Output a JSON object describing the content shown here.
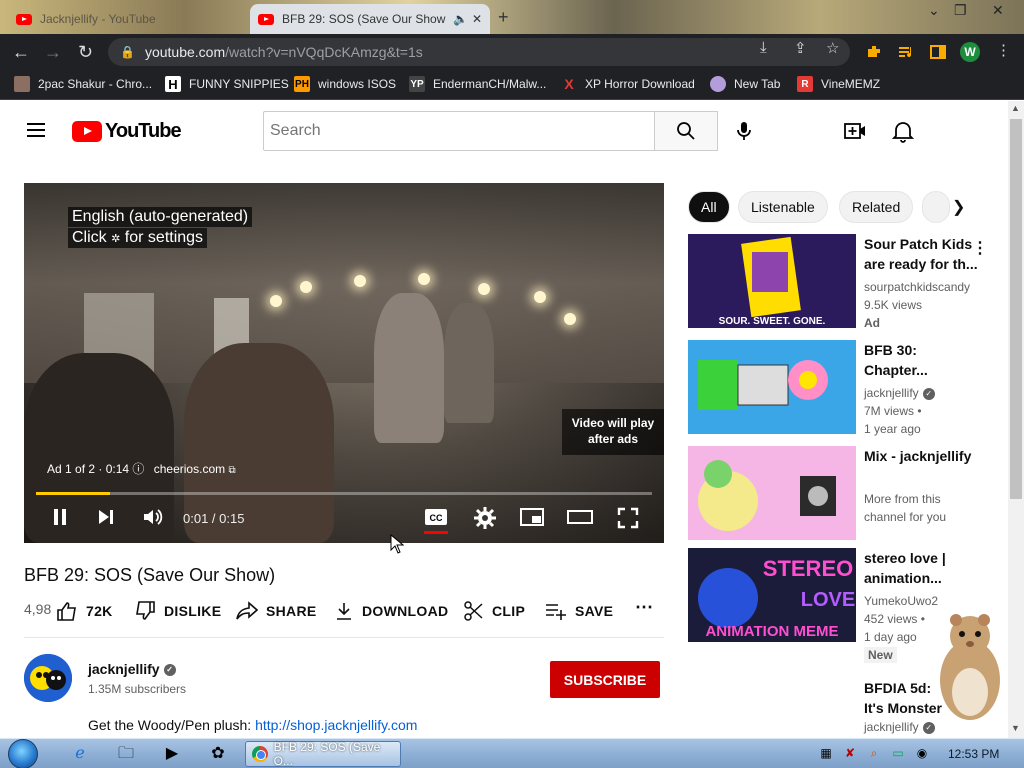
{
  "browser": {
    "tabs": [
      {
        "title": "Jacknjellify - YouTube",
        "active": false
      },
      {
        "title": "BFB 29: SOS (Save Our Show",
        "active": true
      }
    ],
    "new_tab_icon": "plus-icon",
    "url_host": "youtube.com",
    "url_path": "/watch?v=nVQqDcKAmzg&t=1s",
    "profile_initial": "W",
    "bookmarks": [
      {
        "label": "2pac Shakur - Chro...",
        "icon": "tupac-icon",
        "color": "#c0392b"
      },
      {
        "label": "FUNNY SNIPPIES",
        "icon": "H",
        "color": "#333333"
      },
      {
        "label": "windows ISOS",
        "icon": "PH",
        "color": "#ff9900"
      },
      {
        "label": "EndermanCH/Malw...",
        "icon": "YP",
        "color": "#444444"
      },
      {
        "label": "XP Horror Download",
        "icon": "X",
        "color": "#d32f2f"
      },
      {
        "label": "New Tab",
        "icon": "globe-icon",
        "color": "#8e44ad"
      },
      {
        "label": "VineMEMZ",
        "icon": "R",
        "color": "#e53935"
      }
    ]
  },
  "youtube": {
    "logo_text": "YouTube",
    "search_placeholder": "Search",
    "player": {
      "caption_line1": "English (auto-generated)",
      "caption_line2a": "Click",
      "caption_line2b": "for settings",
      "skip_line1": "Video will play",
      "skip_line2": "after ads",
      "ad_counter": "Ad 1 of 2 · 0:14",
      "ad_domain": "cheerios.com",
      "time": "0:01 / 0:15",
      "progress_fraction": 0.12,
      "progress_color": "#ffcc00"
    },
    "video": {
      "title": "BFB 29: SOS (Save Our Show)",
      "views_partial": "4,98",
      "likes": "72K",
      "dislike_label": "DISLIKE",
      "share_label": "SHARE",
      "download_label": "DOWNLOAD",
      "clip_label": "CLIP",
      "save_label": "SAVE"
    },
    "channel": {
      "name": "jacknjellify",
      "subscribers": "1.35M subscribers",
      "subscribe_label": "SUBSCRIBE",
      "desc_prefix": "Get the Woody/Pen plush: ",
      "desc_link": "http://shop.jacknjellify.com"
    },
    "chips": [
      "All",
      "Listenable",
      "Related"
    ],
    "recommendations": [
      {
        "title": "Sour Patch Kids are ready for th...",
        "channel": "sourpatchkidscandy",
        "views": "9.5K views",
        "extra": "Ad"
      },
      {
        "title": "BFB 30: Chapter...",
        "channel": "jacknjellify",
        "views": "7M views •",
        "extra": "1 year ago"
      },
      {
        "title": "Mix - jacknjellify",
        "channel": "More from this",
        "views": "channel for you",
        "extra": ""
      },
      {
        "title": "stereo love | animation...",
        "channel": "YumekoUwo2",
        "views": "452 views •",
        "extra": "1 day ago",
        "badge": "New"
      },
      {
        "title": "BFDIA 5d: It's Monster",
        "channel": "jacknjellify",
        "views": "",
        "extra": ""
      }
    ]
  },
  "taskbar": {
    "task_title": "BFB 29: SOS (Save O...",
    "clock": "12:53 PM"
  }
}
